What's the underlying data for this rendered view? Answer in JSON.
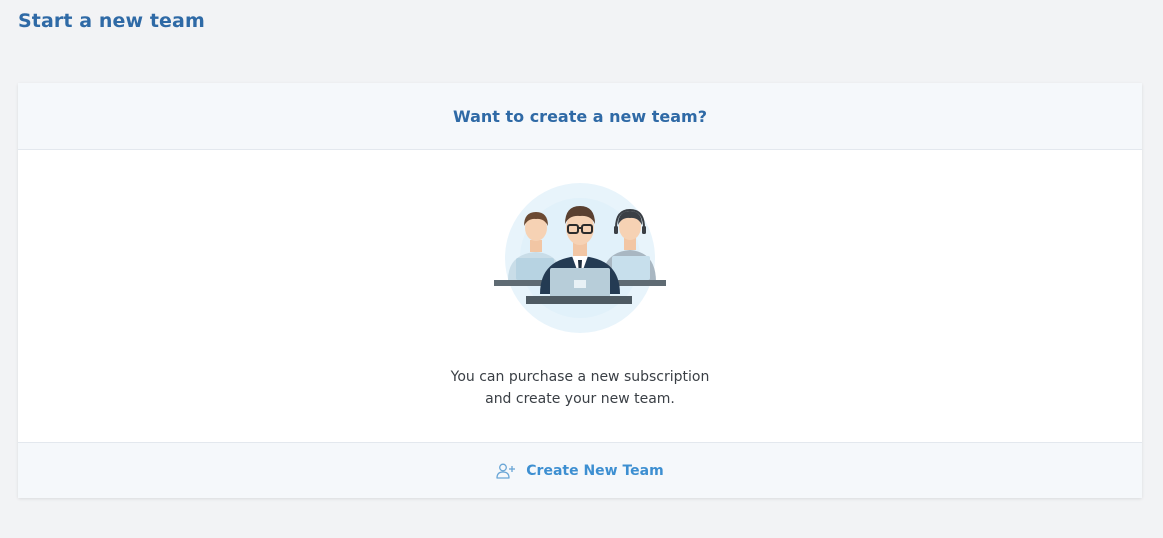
{
  "page": {
    "title": "Start a new team"
  },
  "card": {
    "header_title": "Want to create a new team?",
    "illustration_icon": "team-at-laptops-illustration",
    "description_line1": "You can purchase a new subscription",
    "description_line2": "and create your new team.",
    "create_button_label": "Create New Team",
    "create_button_icon": "add-user-icon"
  },
  "colors": {
    "page_background": "#f2f3f5",
    "title_blue": "#2f6aa6",
    "button_blue": "#3d8fd1",
    "panel_background": "#f5f8fb"
  }
}
